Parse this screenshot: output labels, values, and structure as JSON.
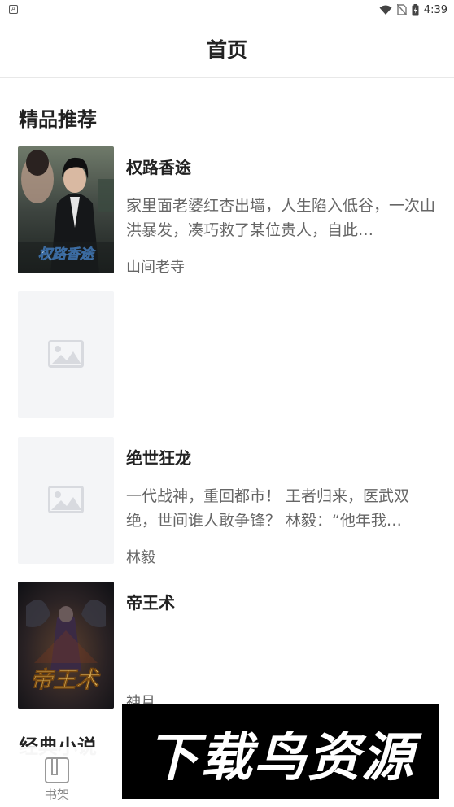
{
  "status_bar": {
    "left_icon_letter": "A",
    "time": "4:39",
    "icons": [
      "wifi-icon",
      "no-sim-icon",
      "battery-icon"
    ]
  },
  "header": {
    "title": "首页"
  },
  "section_featured": {
    "title": "精品推荐",
    "books": [
      {
        "title": "权路香途",
        "description": "家里面老婆红杏出墙，人生陷入低谷，一次山洪暴发，凑巧救了某位贵人，自此…",
        "author": "山间老寺",
        "cover": "cover-image",
        "cover_text": "权路香途"
      },
      {
        "title": "",
        "description": "",
        "author": "",
        "cover": "image-placeholder-icon"
      },
      {
        "title": "绝世狂龙",
        "description": "一代战神，重回都市！ 王者归来，医武双绝，世间谁人敢争锋？ 林毅：“他年我…",
        "author": "林毅",
        "cover": "image-placeholder-icon"
      },
      {
        "title": "帝王术",
        "description": "",
        "author": "神月",
        "cover": "cover-image",
        "cover_text": "帝王术"
      }
    ]
  },
  "section_classic": {
    "title": "经典小说"
  },
  "bottom_nav": {
    "items": [
      {
        "label": "书架",
        "icon": "bookshelf-icon"
      }
    ]
  },
  "watermark": {
    "text": "下载鸟资源"
  }
}
